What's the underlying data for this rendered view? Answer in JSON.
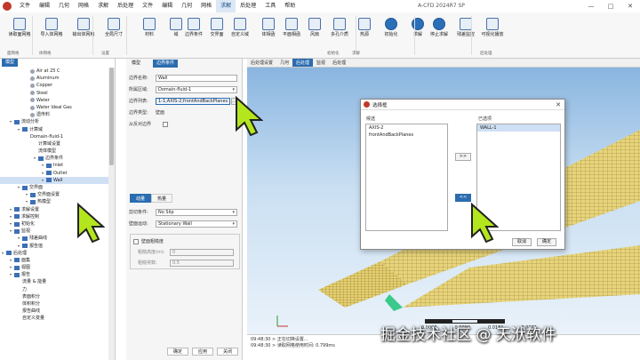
{
  "titlebar": {
    "menus": [
      "文件",
      "编辑",
      "几何",
      "网格",
      "求解",
      "后处理",
      "工具",
      "帮助"
    ],
    "ribbon_menus": [
      "文件",
      "编辑",
      "几何",
      "网格",
      "求解",
      "后处理",
      "工具",
      "帮助"
    ],
    "active_menu_index": 12,
    "app_title": "A-CFD 2024R7 SP",
    "window_controls": [
      "—",
      "□",
      "✕"
    ]
  },
  "ribbon": {
    "buttons": [
      "读取面网格",
      "导入体网格",
      "输出体网格",
      "全局尺寸",
      "材料",
      "域",
      "边界条件",
      "交界面",
      "自定义域",
      "体相函",
      "平面相函",
      "风扇",
      "多孔介质",
      "热源",
      "初始化",
      "求解",
      "停止求解",
      "残差监控",
      "可视化播放"
    ],
    "groups": [
      "面网格",
      "体网格",
      "",
      "设置",
      "",
      "",
      "",
      "",
      "",
      "",
      "",
      "",
      "初始化",
      "求解",
      "",
      "",
      "",
      "",
      "后处理"
    ]
  },
  "left_panel": {
    "tab": "模型",
    "tree": [
      {
        "label": "Air at 25 C",
        "indent": 3,
        "icon": "dot"
      },
      {
        "label": "Aluminum",
        "indent": 3,
        "icon": "dot"
      },
      {
        "label": "Copper",
        "indent": 3,
        "icon": "dot"
      },
      {
        "label": "Steel",
        "indent": 3,
        "icon": "dot"
      },
      {
        "label": "Water",
        "indent": 3,
        "icon": "dot"
      },
      {
        "label": "Water Ideal Gas",
        "indent": 3,
        "icon": "dot"
      },
      {
        "label": "遗传料",
        "indent": 3,
        "icon": "dot"
      },
      {
        "label": "流动分析",
        "indent": 1,
        "icon": "folder"
      },
      {
        "label": "计算域",
        "indent": 2,
        "icon": "folder"
      },
      {
        "label": "Domain-fluid-1",
        "indent": 3,
        "icon": "none"
      },
      {
        "label": "计算域设置",
        "indent": 4,
        "icon": "none"
      },
      {
        "label": "流体模型",
        "indent": 4,
        "icon": "none"
      },
      {
        "label": "边界条件",
        "indent": 4,
        "icon": "folder"
      },
      {
        "label": "Inlet",
        "indent": 5,
        "icon": "folder"
      },
      {
        "label": "Outlet",
        "indent": 5,
        "icon": "folder"
      },
      {
        "label": "Wall",
        "indent": 5,
        "icon": "folder",
        "selected": true
      },
      {
        "label": "交界面",
        "indent": 2,
        "icon": "folder"
      },
      {
        "label": "交界面设置",
        "indent": 3,
        "icon": "folder"
      },
      {
        "label": "热模型",
        "indent": 3,
        "icon": "folder"
      },
      {
        "label": "求解设置",
        "indent": 1,
        "icon": "folder"
      },
      {
        "label": "求解控制",
        "indent": 1,
        "icon": "folder"
      },
      {
        "label": "初始化",
        "indent": 1,
        "icon": "folder"
      },
      {
        "label": "监视",
        "indent": 1,
        "icon": "folder"
      },
      {
        "label": "残差曲线",
        "indent": 2,
        "icon": "folder"
      },
      {
        "label": "报告值",
        "indent": 2,
        "icon": "folder"
      },
      {
        "label": "后处理",
        "indent": 0,
        "icon": "folder"
      },
      {
        "label": "面集",
        "indent": 1,
        "icon": "folder"
      },
      {
        "label": "视图",
        "indent": 1,
        "icon": "folder"
      },
      {
        "label": "报告",
        "indent": 1,
        "icon": "folder"
      },
      {
        "label": "流量 & 能量",
        "indent": 2,
        "icon": "none"
      },
      {
        "label": "力",
        "indent": 2,
        "icon": "none"
      },
      {
        "label": "表面积分",
        "indent": 2,
        "icon": "none"
      },
      {
        "label": "体积积分",
        "indent": 2,
        "icon": "none"
      },
      {
        "label": "报告曲线",
        "indent": 2,
        "icon": "none"
      },
      {
        "label": "自定义变量",
        "indent": 2,
        "icon": "none"
      }
    ]
  },
  "mid_panel": {
    "tabs": [
      "模型",
      "边界条件"
    ],
    "fields": [
      {
        "label": "边界名称:",
        "value": "Wall"
      },
      {
        "label": "所属区域:",
        "value": "Domain-fluid-1"
      },
      {
        "label": "边界列表:",
        "value": "1-1;AXIS-2;frontAndBackPlanes"
      },
      {
        "label": "边界类型:",
        "value": "壁面"
      },
      {
        "label": "从反对边界",
        "value": ""
      }
    ],
    "sub_tabs": [
      "动量",
      "热量"
    ],
    "momentum": [
      {
        "label": "剪切条件:",
        "value": "No Slip"
      },
      {
        "label": "壁面运动:",
        "value": "Stationary Wall"
      }
    ],
    "roughness": {
      "label": "壁面粗糙度",
      "height_label": "粗糙高度(m):",
      "height_value": "0",
      "const_label": "粗糙常数:",
      "const_value": "0.5"
    },
    "buttons": [
      "确定",
      "应用",
      "关闭"
    ]
  },
  "canvas": {
    "tabs": [
      "后处理设置",
      "几何",
      "后处理",
      "监视",
      "后处理"
    ],
    "active_tab_index": 2,
    "scale_labels": [
      "0.0000",
      "0.0090",
      "0.0181",
      "0.0271"
    ],
    "console": [
      "09:48:30 > 正在切换设置...",
      "09:48:30 > 读取网格使用时间: 0.799ms"
    ]
  },
  "dialog": {
    "title": "选择框",
    "left_label": "候选",
    "right_label": "已选项",
    "left_items": [
      "AXIS-2",
      "frontAndBackPlanes"
    ],
    "right_items": [
      "WALL-1"
    ],
    "arrow_right": ">>",
    "arrow_left": "<<",
    "ok": "确定",
    "cancel": "取消",
    "close": "✕"
  },
  "watermark": "掘金技术社区 @ 天洑软件",
  "colors": {
    "accent": "#2b6cb0",
    "mesh": "#e8d47a",
    "cursor": "#b4e61e"
  }
}
